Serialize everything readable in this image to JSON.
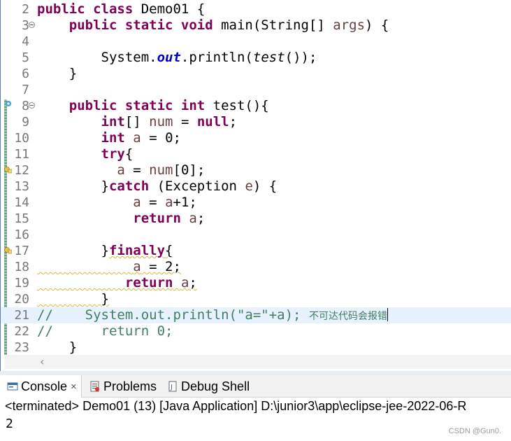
{
  "editor": {
    "lines": [
      {
        "num": "2",
        "text": "public class Demo01 {"
      },
      {
        "num": "3",
        "text": "    public static void main(String[] args) {"
      },
      {
        "num": "4",
        "text": ""
      },
      {
        "num": "5",
        "text": "        System.out.println(test());"
      },
      {
        "num": "6",
        "text": "    }"
      },
      {
        "num": "7",
        "text": ""
      },
      {
        "num": "8",
        "text": "    public static int test(){"
      },
      {
        "num": "9",
        "text": "        int[] num = null;"
      },
      {
        "num": "10",
        "text": "        int a = 0;"
      },
      {
        "num": "11",
        "text": "        try{"
      },
      {
        "num": "12",
        "text": "          a = num[0];"
      },
      {
        "num": "13",
        "text": "        }catch (Exception e) {"
      },
      {
        "num": "14",
        "text": "            a = a+1;"
      },
      {
        "num": "15",
        "text": "            return a;"
      },
      {
        "num": "16",
        "text": ""
      },
      {
        "num": "17",
        "text": "        }finally{"
      },
      {
        "num": "18",
        "text": "            a = 2;"
      },
      {
        "num": "19",
        "text": "           return a;"
      },
      {
        "num": "20",
        "text": "        }"
      },
      {
        "num": "21",
        "text": "//    System.out.println(\"a=\"+a);",
        "comment_cjk": "不可达代码会报错"
      },
      {
        "num": "22",
        "text": "//      return 0;"
      },
      {
        "num": "23",
        "text": "    }"
      }
    ]
  },
  "panel": {
    "tabs": [
      {
        "label": "Console",
        "icon": "console-icon",
        "active": true,
        "close": "×"
      },
      {
        "label": "Problems",
        "icon": "problems-icon",
        "active": false
      },
      {
        "label": "Debug Shell",
        "icon": "debug-shell-icon",
        "active": false
      }
    ],
    "status": "<terminated> Demo01 (13) [Java Application] D:\\junior3\\app\\eclipse-jee-2022-06-R",
    "output": "2"
  },
  "watermark": "CSDN @Gun0.",
  "colors": {
    "keyword": "#7f0055",
    "variable": "#6a3e3e",
    "field": "#0000c0",
    "comment": "#3f7f5f",
    "current_line": "#e8f2fe"
  }
}
